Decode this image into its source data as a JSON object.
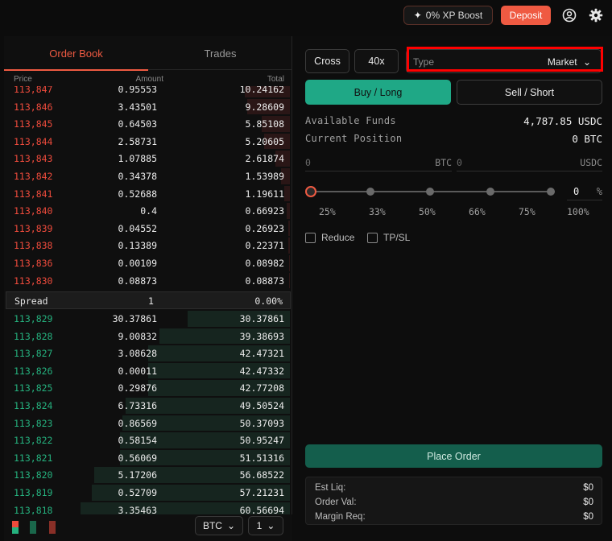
{
  "header": {
    "xp_label": "0% XP Boost",
    "deposit_label": "Deposit"
  },
  "orderbook": {
    "tabs": [
      "Order Book",
      "Trades"
    ],
    "columns": {
      "price": "Price",
      "amount": "Amount",
      "total": "Total"
    },
    "asks": [
      {
        "price": "113,847",
        "amount": "0.95553",
        "total": "10.24162",
        "depth": 0.16
      },
      {
        "price": "113,846",
        "amount": "3.43501",
        "total": "9.28609",
        "depth": 0.15
      },
      {
        "price": "113,845",
        "amount": "0.64503",
        "total": "5.85108",
        "depth": 0.1
      },
      {
        "price": "113,844",
        "amount": "2.58731",
        "total": "5.20605",
        "depth": 0.09
      },
      {
        "price": "113,843",
        "amount": "1.07885",
        "total": "2.61874",
        "depth": 0.05
      },
      {
        "price": "113,842",
        "amount": "0.34378",
        "total": "1.53989",
        "depth": 0.03
      },
      {
        "price": "113,841",
        "amount": "0.52688",
        "total": "1.19611",
        "depth": 0.02
      },
      {
        "price": "113,840",
        "amount": "0.4",
        "total": "0.66923",
        "depth": 0.012
      },
      {
        "price": "113,839",
        "amount": "0.04552",
        "total": "0.26923",
        "depth": 0.006
      },
      {
        "price": "113,838",
        "amount": "0.13389",
        "total": "0.22371",
        "depth": 0.005
      },
      {
        "price": "113,836",
        "amount": "0.00109",
        "total": "0.08982",
        "depth": 0.003
      },
      {
        "price": "113,830",
        "amount": "0.08873",
        "total": "0.08873",
        "depth": 0.003
      }
    ],
    "spread": {
      "label": "Spread",
      "value": "1",
      "percent": "0.00%"
    },
    "bids": [
      {
        "price": "113,829",
        "amount": "30.37861",
        "total": "30.37861",
        "depth": 0.36
      },
      {
        "price": "113,828",
        "amount": "9.00832",
        "total": "39.38693",
        "depth": 0.46
      },
      {
        "price": "113,827",
        "amount": "3.08628",
        "total": "42.47321",
        "depth": 0.5
      },
      {
        "price": "113,826",
        "amount": "0.00011",
        "total": "42.47332",
        "depth": 0.5
      },
      {
        "price": "113,825",
        "amount": "0.29876",
        "total": "42.77208",
        "depth": 0.5
      },
      {
        "price": "113,824",
        "amount": "6.73316",
        "total": "49.50524",
        "depth": 0.58
      },
      {
        "price": "113,823",
        "amount": "0.86569",
        "total": "50.37093",
        "depth": 0.59
      },
      {
        "price": "113,822",
        "amount": "0.58154",
        "total": "50.95247",
        "depth": 0.6
      },
      {
        "price": "113,821",
        "amount": "0.56069",
        "total": "51.51316",
        "depth": 0.6
      },
      {
        "price": "113,820",
        "amount": "5.17206",
        "total": "56.68522",
        "depth": 0.69
      },
      {
        "price": "113,819",
        "amount": "0.52709",
        "total": "57.21231",
        "depth": 0.7
      },
      {
        "price": "113,818",
        "amount": "3.35463",
        "total": "60.56694",
        "depth": 0.74
      }
    ],
    "unit_select": "BTC",
    "grouping_select": "1"
  },
  "order_form": {
    "margin_mode": "Cross",
    "leverage": "40x",
    "type_label": "Type",
    "type_value": "Market",
    "buy_label": "Buy / Long",
    "sell_label": "Sell / Short",
    "available_funds_label": "Available Funds",
    "available_funds_value": "4,787.85 USDC",
    "current_position_label": "Current Position",
    "current_position_value": "0 BTC",
    "btc_input_placeholder": "0",
    "btc_input_unit": "BTC",
    "usdc_input_placeholder": "0",
    "usdc_input_unit": "USDC",
    "size_percent_value": "0",
    "size_percent_unit": "%",
    "percent_marks": [
      "25%",
      "33%",
      "50%",
      "66%",
      "75%",
      "100%"
    ],
    "reduce_label": "Reduce",
    "tpsl_label": "TP/SL",
    "place_order_label": "Place Order",
    "summary": [
      {
        "label": "Est Liq:",
        "value": "$0"
      },
      {
        "label": "Order Val:",
        "value": "$0"
      },
      {
        "label": "Margin Req:",
        "value": "$0"
      }
    ]
  },
  "colors": {
    "accent": "#ef5a42",
    "ask": "#ee4b3c",
    "bid": "#25b17e",
    "buy_button": "#1fa886"
  }
}
